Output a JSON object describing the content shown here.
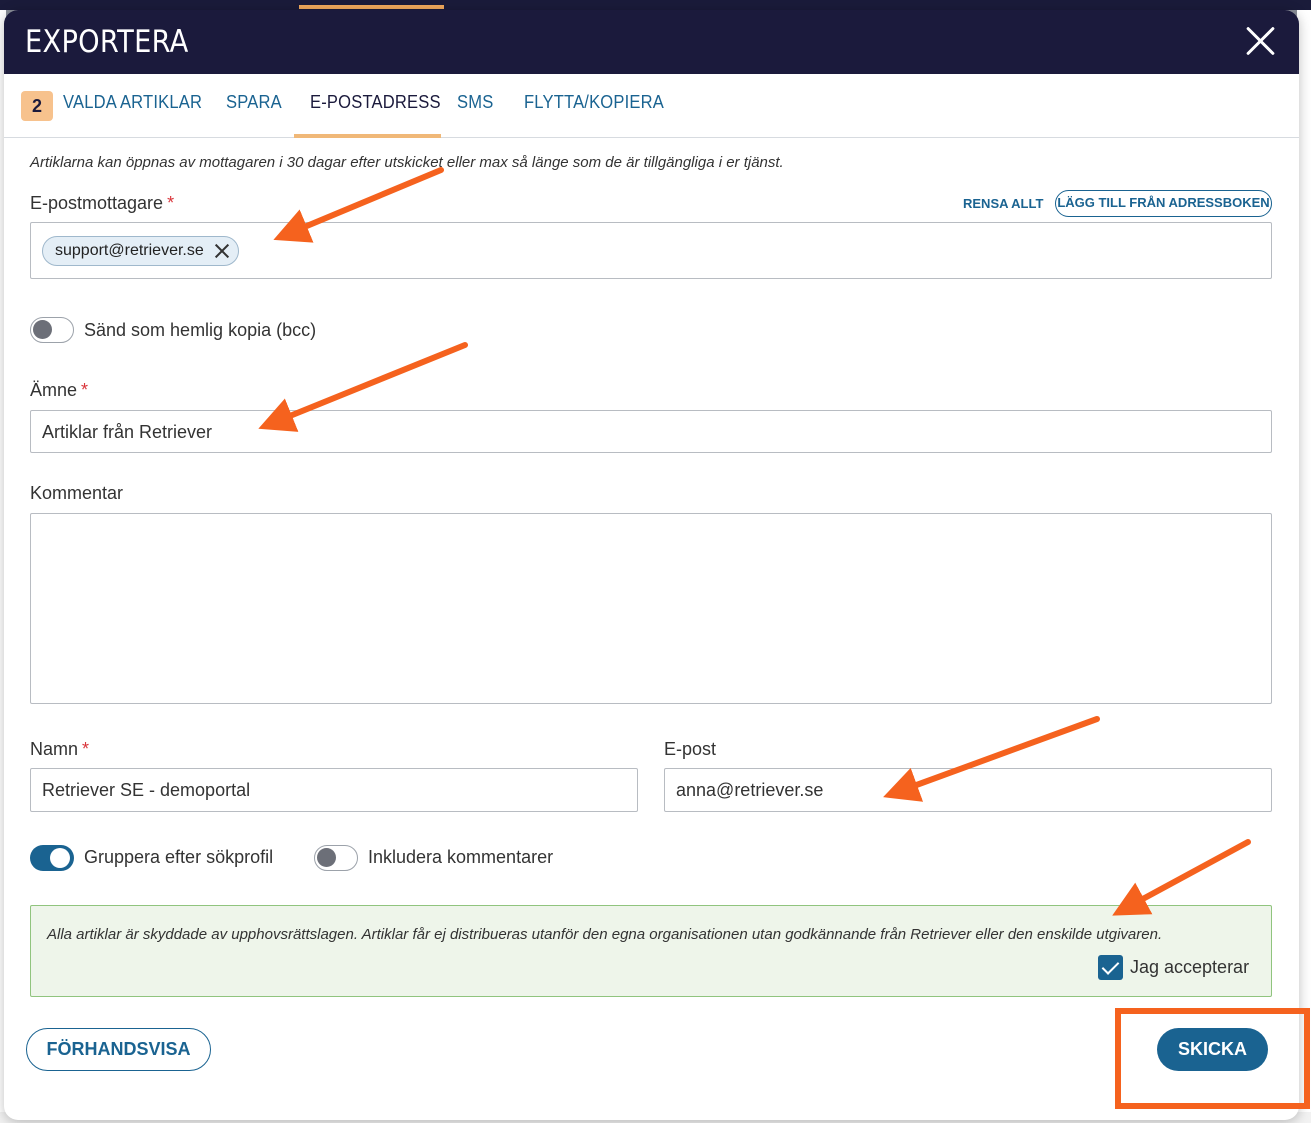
{
  "modal": {
    "title": "EXPORTERA"
  },
  "tabs": {
    "badge_count": "2",
    "items": [
      {
        "label": "VALDA ARTIKLAR",
        "active": false
      },
      {
        "label": "SPARA",
        "active": false
      },
      {
        "label": "E-POSTADRESS",
        "active": true
      },
      {
        "label": "SMS",
        "active": false
      },
      {
        "label": "FLYTTA/KOPIERA",
        "active": false
      }
    ]
  },
  "form": {
    "info_text": "Artiklarna kan öppnas av mottagaren i 30 dagar efter utskicket eller max så länge som de är tillgängliga i er tjänst.",
    "recipients": {
      "label": "E-postmottagare",
      "required_mark": "*",
      "clear_all": "RENSA ALLT",
      "add_from_addressbook": "LÄGG TILL FRÅN ADRESSBOKEN",
      "chips": [
        "support@retriever.se"
      ]
    },
    "bcc": {
      "label": "Sänd som hemlig kopia (bcc)",
      "checked": false
    },
    "subject": {
      "label": "Ämne",
      "required_mark": "*",
      "value": "Artiklar från Retriever"
    },
    "comment": {
      "label": "Kommentar",
      "value": ""
    },
    "name": {
      "label": "Namn",
      "required_mark": "*",
      "value": "Retriever SE - demoportal"
    },
    "email": {
      "label": "E-post",
      "value": "anna@retriever.se"
    },
    "group_by_profile": {
      "label": "Gruppera efter sökprofil",
      "checked": true
    },
    "include_comments": {
      "label": "Inkludera kommentarer",
      "checked": false
    },
    "notice": {
      "text": "Alla artiklar är skyddade av upphovsrättslagen. Artiklar får ej distribueras utanför den egna organisationen utan godkännande från Retriever eller den enskilde utgivaren.",
      "accept_label": "Jag accepterar",
      "accepted": true
    }
  },
  "footer": {
    "preview_label": "FÖRHANDSVISA",
    "send_label": "SKICKA"
  },
  "colors": {
    "header_bg": "#1b1a3c",
    "accent_blue": "#1a6391",
    "tab_badge": "#f7c28d",
    "annotation_orange": "#f5621e",
    "notice_bg": "#eef5ea",
    "required_red": "#d9343a"
  }
}
